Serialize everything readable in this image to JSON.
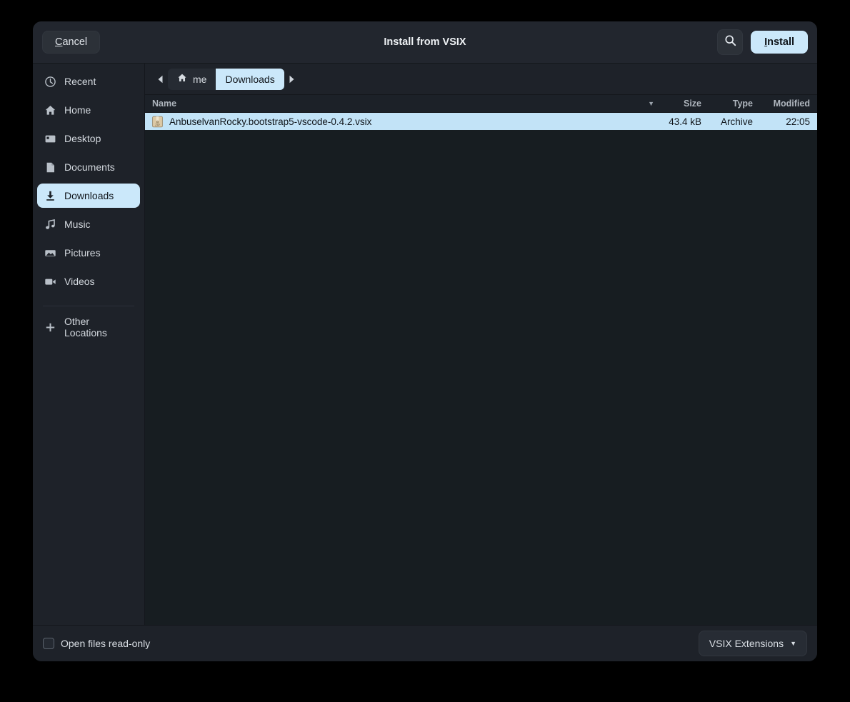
{
  "header": {
    "cancel_label": "Cancel",
    "cancel_mnemonic": "C",
    "cancel_rest": "ancel",
    "title": "Install from VSIX",
    "search_icon": "search-icon",
    "install_mnemonic": "I",
    "install_rest": "nstall",
    "install_label": "Install"
  },
  "sidebar": {
    "items": [
      {
        "label": "Recent",
        "icon": "clock-icon",
        "selected": false
      },
      {
        "label": "Home",
        "icon": "home-icon",
        "selected": false
      },
      {
        "label": "Desktop",
        "icon": "monitor-icon",
        "selected": false
      },
      {
        "label": "Documents",
        "icon": "document-icon",
        "selected": false
      },
      {
        "label": "Downloads",
        "icon": "download-icon",
        "selected": true
      },
      {
        "label": "Music",
        "icon": "music-note-icon",
        "selected": false
      },
      {
        "label": "Pictures",
        "icon": "picture-icon",
        "selected": false
      },
      {
        "label": "Videos",
        "icon": "video-camera-icon",
        "selected": false
      }
    ],
    "other_locations": {
      "label": "Other Locations",
      "icon": "plus-icon"
    }
  },
  "pathbar": {
    "back_icon": "triangle-left-icon",
    "forward_icon": "triangle-right-icon",
    "crumbs": [
      {
        "label": "me",
        "icon": "home-icon",
        "selected": false
      },
      {
        "label": "Downloads",
        "icon": "",
        "selected": true
      }
    ]
  },
  "filelist": {
    "columns": {
      "name": "Name",
      "size": "Size",
      "type": "Type",
      "modified": "Modified"
    },
    "sort_arrow": "▼",
    "rows": [
      {
        "name": "AnbuselvanRocky.bootstrap5-vscode-0.4.2.vsix",
        "size": "43.4 kB",
        "type": "Archive",
        "modified": "22:05",
        "icon": "zip-archive-icon",
        "selected": true
      }
    ]
  },
  "footer": {
    "readonly_label": "Open files read-only",
    "readonly_checked": false,
    "filter_label": "VSIX Extensions",
    "filter_caret": "▼"
  },
  "colors": {
    "accent_light_blue": "#cbe8fa",
    "row_selected": "#c2e3f7",
    "window_bg": "#171d21",
    "sidebar_bg": "#1e2229",
    "header_bg": "#22262e",
    "text_primary": "#d9dee4",
    "zip_icon": "#d9c7a8"
  }
}
